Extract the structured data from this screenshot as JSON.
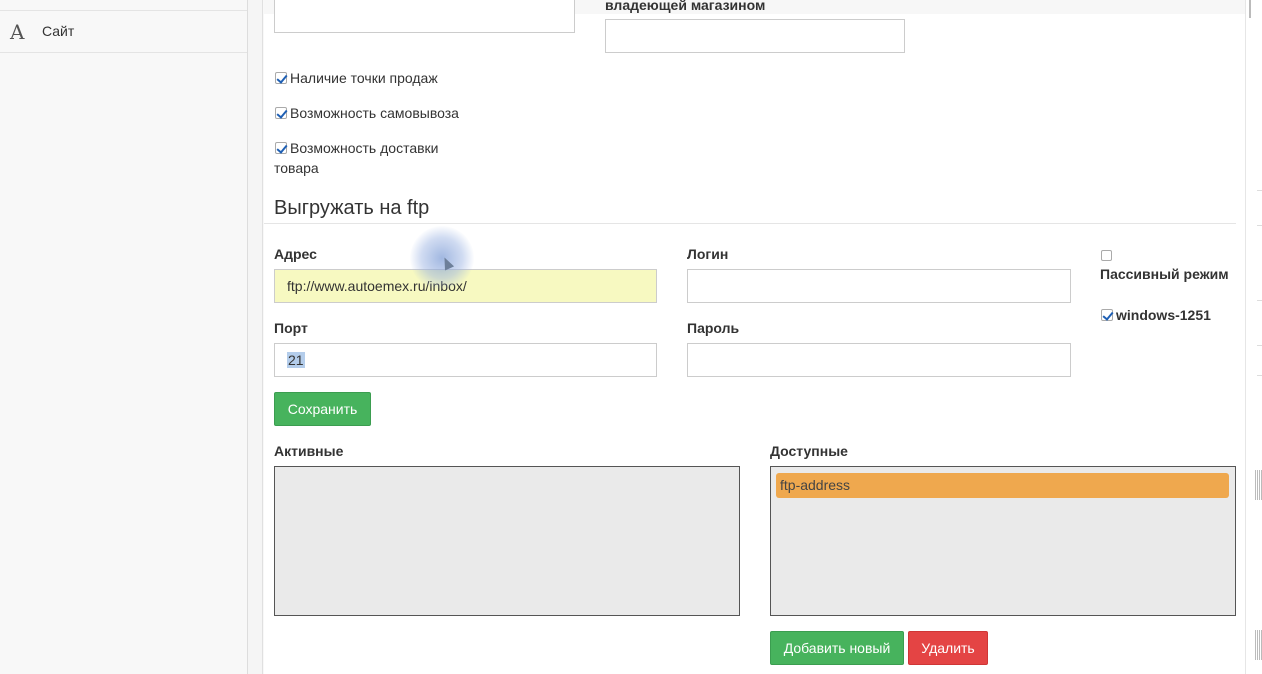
{
  "sidebar": {
    "items": [
      {
        "icon": "font-icon",
        "glyph": "A",
        "label": "Сайт"
      }
    ]
  },
  "shop": {
    "owner_label_fragment": "владеющей магазином",
    "checkboxes": [
      {
        "label": "Наличие точки продаж",
        "checked": true
      },
      {
        "label": "Возможность самовывоза",
        "checked": true
      },
      {
        "label_line1": "Возможность доставки",
        "label_line2": "товара",
        "checked": true
      }
    ]
  },
  "ftp": {
    "title": "Выгружать на ftp",
    "address_label": "Адрес",
    "address_value": "ftp://www.autoemex.ru/inbox/",
    "login_label": "Логин",
    "login_value": "",
    "port_label": "Порт",
    "port_value": "21",
    "password_label": "Пароль",
    "password_value": "",
    "passive_label": "Пассивный режим",
    "passive_checked": false,
    "encoding_label": "windows-1251",
    "encoding_checked": true,
    "save_button": "Сохранить"
  },
  "lists": {
    "active_label": "Активные",
    "active_items": [],
    "available_label": "Доступные",
    "available_items": [
      "ftp-address"
    ],
    "add_button": "Добавить новый",
    "delete_button": "Удалить"
  },
  "colors": {
    "save_green": "#47b35d",
    "delete_red": "#e44444",
    "tag_orange": "#efa84e",
    "autofill_yellow": "#f7f9c1"
  }
}
